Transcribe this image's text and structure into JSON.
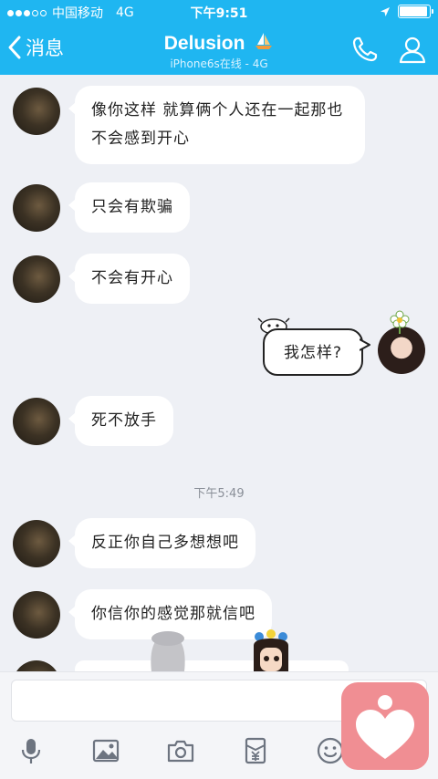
{
  "status_bar": {
    "carrier": "中国移动",
    "network": "4G",
    "time": "下午9:51",
    "battery_level": 0.95
  },
  "nav": {
    "back_label": "消息",
    "title": "Delusion",
    "subtitle": "iPhone6s在线 - 4G"
  },
  "messages": [
    {
      "text": "像你这样  就算俩个人还在一起那也不会感到开心"
    },
    {
      "text": "只会有欺骗"
    },
    {
      "text": "不会有开心"
    },
    {
      "text": "我怎样?"
    },
    {
      "text": "死不放手"
    },
    {
      "text": "反正你自己多想想吧"
    },
    {
      "text": "你信你的感觉那就信吧"
    }
  ],
  "timestamp": "下午5:49",
  "icons": [
    "back-chevron-icon",
    "phone-icon",
    "profile-icon",
    "microphone-icon",
    "image-icon",
    "camera-icon",
    "red-packet-icon",
    "emoji-icon",
    "heart-sticker-icon"
  ],
  "colors": {
    "nav_blue": "#1fb6f1",
    "chat_bg": "#eef0f5",
    "sticker_pink": "#f08e93"
  }
}
